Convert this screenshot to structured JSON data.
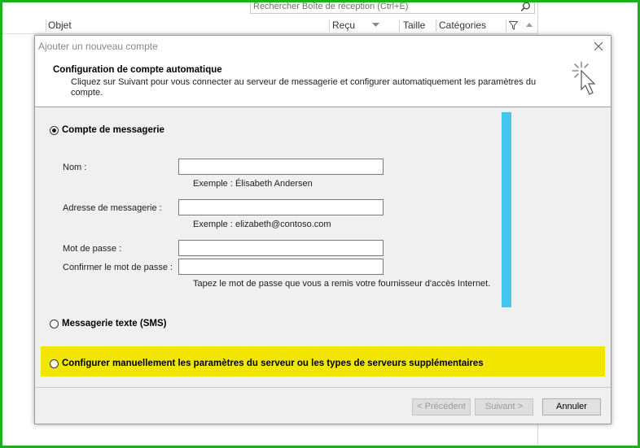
{
  "outlook": {
    "search_placeholder": "Rechercher Boîte de réception (Ctrl+E)",
    "columns": {
      "object": "Objet",
      "received": "Reçu",
      "size": "Taille",
      "categories": "Catégories"
    }
  },
  "dialog": {
    "title": "Ajouter un nouveau compte",
    "header_title": "Configuration de compte automatique",
    "header_desc": "Cliquez sur Suivant pour vous connecter au serveur de messagerie et configurer automatiquement les paramètres du compte.",
    "options": {
      "email_account": "Compte de messagerie",
      "sms": "Messagerie texte (SMS)",
      "manual": "Configurer manuellement les paramètres du serveur ou les types de serveurs supplémentaires"
    },
    "fields": {
      "name_label": "Nom :",
      "name_hint": "Exemple : Élisabeth Andersen",
      "email_label": "Adresse de messagerie :",
      "email_hint": "Exemple : elizabeth@contoso.com",
      "password_label": "Mot de passe :",
      "confirm_label": "Confirmer le mot de passe :",
      "password_hint": "Tapez le mot de passe que vous a remis votre fournisseur d'accès Internet."
    },
    "buttons": {
      "previous": "< Précédent",
      "next": "Suivant >",
      "cancel": "Annuler"
    }
  },
  "colors": {
    "highlight_yellow": "#f2e600",
    "highlight_cyan": "#43c6ee",
    "frame_green": "#1fae1f"
  }
}
